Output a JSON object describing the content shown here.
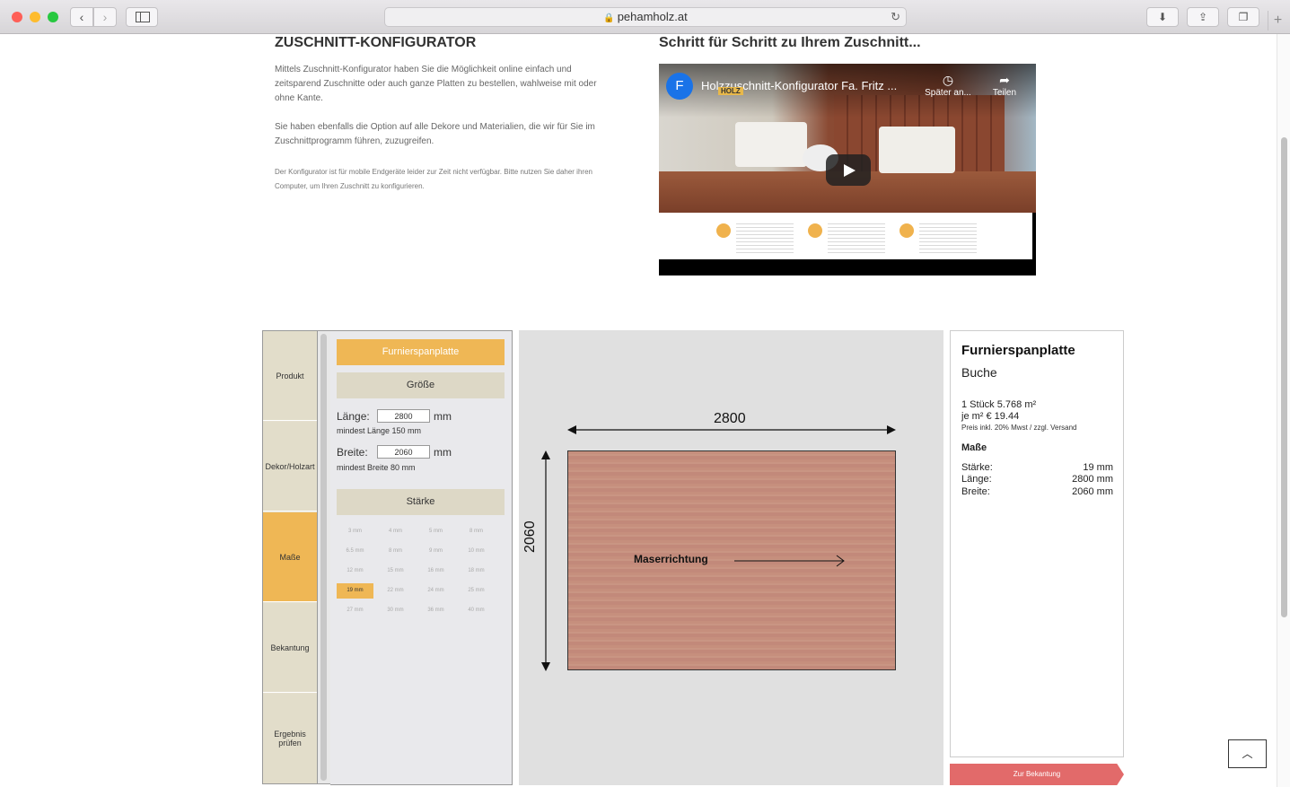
{
  "browser": {
    "url": "pehamholz.at"
  },
  "intro": {
    "heading": "ZUSCHNITT-KONFIGURATOR",
    "para1": "Mittels Zuschnitt-Konfigurator haben Sie die Möglichkeit online einfach und zeitsparend Zuschnitte oder auch ganze Platten zu bestellen, wahlweise mit oder ohne Kante.",
    "para2": "Sie haben ebenfalls die Option auf alle Dekore und Materialien, die wir für Sie im Zuschnittprogramm führen, zuzugreifen.",
    "para3": "Der Konfigurator ist für mobile Endgeräte leider zur Zeit nicht verfügbar. Bitte nutzen Sie daher ihren Computer, um Ihren Zuschnitt zu konfigurieren."
  },
  "video_section": {
    "heading": "Schritt für Schritt zu Ihrem Zuschnitt...",
    "channel_initial": "F",
    "title": "Holzzuschnitt-Konfigurator Fa. Fritz ...",
    "brand_tag": "HOLZ",
    "later_label": "Später an...",
    "share_label": "Teilen"
  },
  "steps": {
    "items": [
      {
        "label": "Produkt"
      },
      {
        "label": "Dekor/Holzart"
      },
      {
        "label": "Maße"
      },
      {
        "label": "Bekantung"
      },
      {
        "label": "Ergebnis prüfen"
      }
    ],
    "active": "Maße"
  },
  "options": {
    "product": "Furnierspanplatte",
    "size_head": "Größe",
    "length_label": "Länge:",
    "length_value": "2800",
    "length_unit": "mm",
    "length_hint": "mindest Länge 150 mm",
    "width_label": "Breite:",
    "width_value": "2060",
    "width_unit": "mm",
    "width_hint": "mindest Breite 80 mm",
    "thickness_head": "Stärke",
    "thickness_options": [
      "3 mm",
      "4 mm",
      "5 mm",
      "8 mm",
      "6.5 mm",
      "8 mm",
      "9 mm",
      "10 mm",
      "12 mm",
      "15 mm",
      "16 mm",
      "18 mm",
      "19 mm",
      "22 mm",
      "24 mm",
      "25 mm",
      "27 mm",
      "30 mm",
      "36 mm",
      "40 mm"
    ],
    "thickness_selected": "19 mm"
  },
  "preview": {
    "width_label": "2800",
    "height_label": "2060",
    "grain_label": "Maserrichtung"
  },
  "summary": {
    "title": "Furnierspanplatte",
    "decor": "Buche",
    "quantity_area": "1 Stück 5.768 m²",
    "price_per_m2": "je m² € 19.44",
    "price_note": "Preis inkl. 20% Mwst / zzgl. Versand",
    "dims_head": "Maße",
    "rows": [
      {
        "label": "Stärke:",
        "value": "19 mm"
      },
      {
        "label": "Länge:",
        "value": "2800 mm"
      },
      {
        "label": "Breite:",
        "value": "2060 mm"
      }
    ]
  },
  "next_button": "Zur Bekantung",
  "colors": {
    "accent": "#efb755",
    "next_button": "#e26a6a",
    "step_bg": "#e2ddca"
  }
}
